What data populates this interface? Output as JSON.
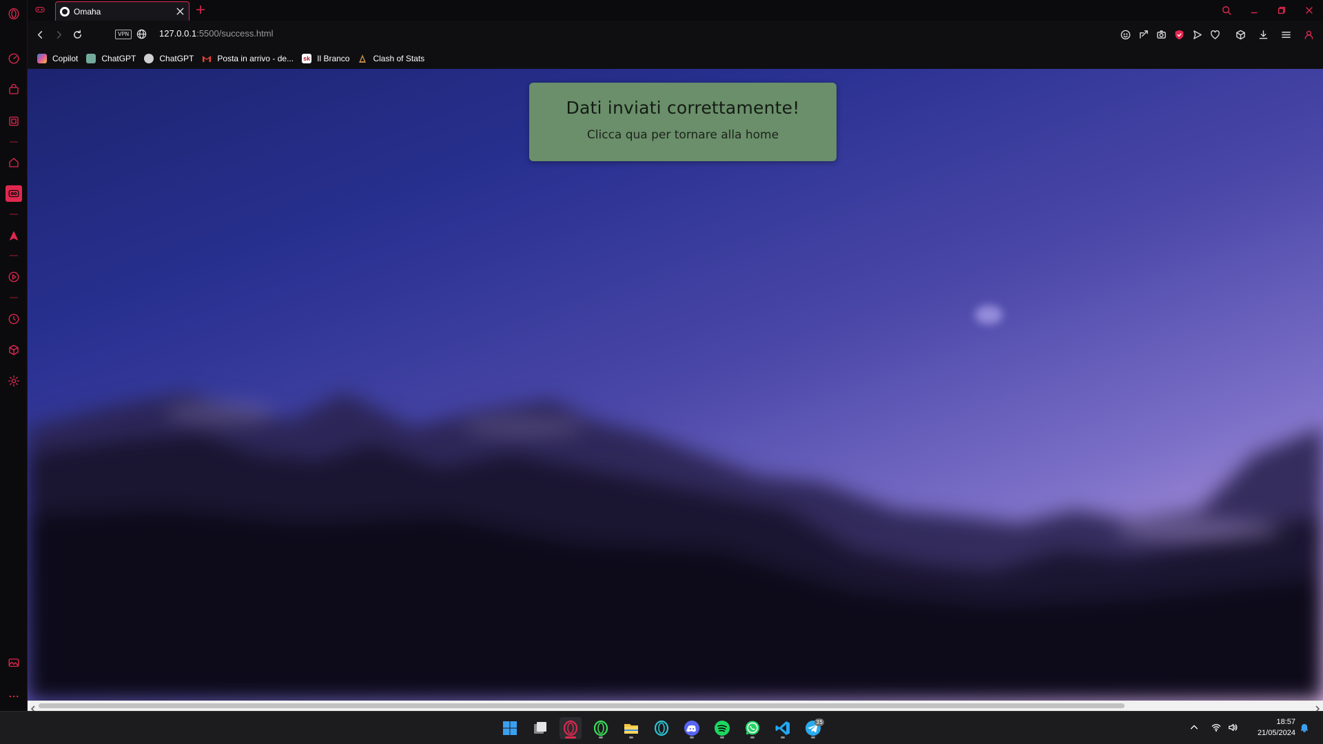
{
  "browser": {
    "tab": {
      "title": "Omaha"
    },
    "address": {
      "host": "127.0.0.1",
      "path": ":5500/success.html",
      "vpn_label": "VPN"
    },
    "bookmarks": [
      {
        "label": "Copilot",
        "icon": "copilot-icon",
        "color": "#3a7bd5"
      },
      {
        "label": "ChatGPT",
        "icon": "chatgpt-icon",
        "color": "#74aa9c"
      },
      {
        "label": "ChatGPT",
        "icon": "chatgpt-icon",
        "color": "#d0d0d0"
      },
      {
        "label": "Posta in arrivo - de...",
        "icon": "gmail-icon",
        "color": "#ea4335"
      },
      {
        "label": "Il Branco",
        "icon": "sk-icon",
        "color": "#b01c30"
      },
      {
        "label": "Clash of Stats",
        "icon": "clash-icon",
        "color": "#c08a40"
      }
    ]
  },
  "page": {
    "title": "Dati inviati correttamente!",
    "link": "Clicca qua per tornare alla home",
    "card_color": "#6a8f6a"
  },
  "taskbar": {
    "apps": [
      "windows-start",
      "task-view",
      "opera",
      "opera-gx",
      "file-explorer",
      "opera-air",
      "discord",
      "spotify",
      "whatsapp",
      "vscode",
      "telegram"
    ],
    "telegram_badge": "35",
    "time": "18:57",
    "date": "21/05/2024"
  },
  "colors": {
    "accent": "#e0284f",
    "sidebar_bg": "#0b0b0d",
    "taskbar_bg": "#1c1c1f"
  }
}
